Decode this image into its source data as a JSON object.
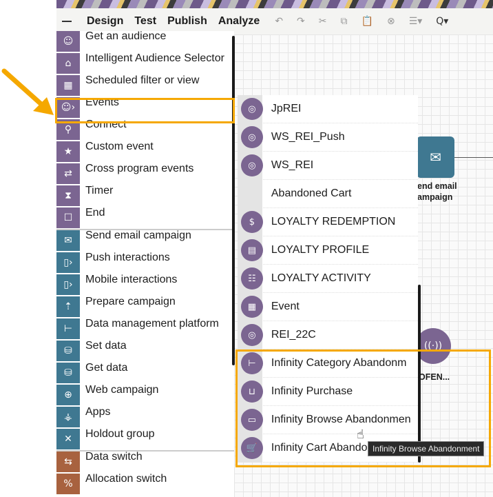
{
  "toolbar": {
    "tabs": [
      "Design",
      "Test",
      "Publish",
      "Analyze"
    ],
    "active_tab": "Design",
    "icons": [
      "undo-icon",
      "redo-icon",
      "cut-icon",
      "copy-icon",
      "paste-icon",
      "delete-icon",
      "align-icon",
      "zoom-icon"
    ]
  },
  "palette": {
    "audience_group": [
      {
        "label": "Get an audience",
        "icon": "audience-icon"
      },
      {
        "label": "Intelligent Audience Selector",
        "icon": "robot-icon"
      },
      {
        "label": "Scheduled filter or view",
        "icon": "calendar-icon"
      },
      {
        "label": "Events",
        "icon": "events-icon"
      },
      {
        "label": "Connect",
        "icon": "connect-icon"
      },
      {
        "label": "Custom event",
        "icon": "custom-event-icon"
      },
      {
        "label": "Cross program events",
        "icon": "cross-program-icon"
      },
      {
        "label": "Timer",
        "icon": "hourglass-icon"
      },
      {
        "label": "End",
        "icon": "end-icon"
      }
    ],
    "action_group": [
      {
        "label": "Send email campaign",
        "icon": "mail-icon"
      },
      {
        "label": "Push interactions",
        "icon": "push-icon"
      },
      {
        "label": "Mobile interactions",
        "icon": "mobile-icon"
      },
      {
        "label": "Prepare campaign",
        "icon": "prepare-icon"
      },
      {
        "label": "Data management platform",
        "icon": "hierarchy-icon"
      },
      {
        "label": "Set data",
        "icon": "set-data-icon"
      },
      {
        "label": "Get data",
        "icon": "get-data-icon"
      },
      {
        "label": "Web campaign",
        "icon": "globe-icon"
      },
      {
        "label": "Apps",
        "icon": "apps-icon"
      },
      {
        "label": "Holdout group",
        "icon": "holdout-icon"
      }
    ],
    "switch_group": [
      {
        "label": "Data switch",
        "icon": "data-switch-icon"
      },
      {
        "label": "Allocation switch",
        "icon": "percent-icon"
      }
    ]
  },
  "events_submenu": [
    {
      "label": "JpREI",
      "icon": "target-icon"
    },
    {
      "label": "WS_REI_Push",
      "icon": "target-icon"
    },
    {
      "label": "WS_REI",
      "icon": "target-icon"
    },
    {
      "label": "Abandoned Cart",
      "icon": ""
    },
    {
      "label": "LOYALTY REDEMPTION",
      "icon": "redemption-icon"
    },
    {
      "label": "LOYALTY PROFILE",
      "icon": "profile-card-icon"
    },
    {
      "label": "LOYALTY ACTIVITY",
      "icon": "activity-icon"
    },
    {
      "label": "Event",
      "icon": "calculator-icon"
    },
    {
      "label": "REI_22C",
      "icon": "target-icon"
    },
    {
      "label": "Infinity Category Abandonm",
      "icon": "category-icon"
    },
    {
      "label": "Infinity Purchase",
      "icon": "bag-icon"
    },
    {
      "label": "Infinity Browse Abandonmen",
      "icon": "browse-icon"
    },
    {
      "label": "Infinity Cart Abandonment",
      "icon": "cart-icon"
    }
  ],
  "tooltip": "Infinity Browse Abandonment",
  "canvas": {
    "email_node_label": "end email\nampaign",
    "event_node_label": "OFEN..."
  },
  "colors": {
    "highlight": "#f5a800",
    "purple": "#7b6591",
    "teal": "#3f7891",
    "brown": "#a8623f"
  }
}
